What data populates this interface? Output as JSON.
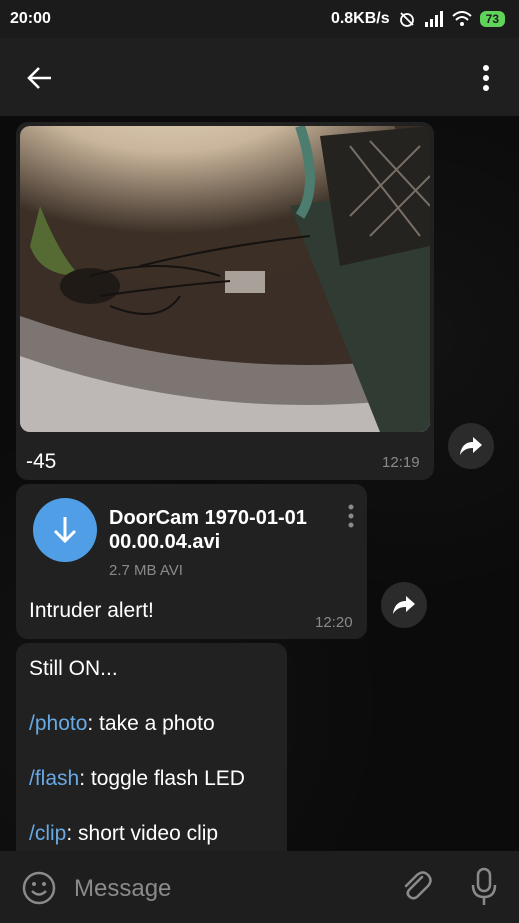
{
  "status_bar": {
    "time": "20:00",
    "network_speed": "0.8KB/s",
    "battery": "73",
    "icons": [
      "alarm-off-icon",
      "signal-icon",
      "wifi-icon",
      "battery-icon"
    ]
  },
  "app_bar": {
    "icons": [
      "back-arrow-icon",
      "more-vertical-icon"
    ]
  },
  "messages": {
    "photo": {
      "caption": "-45",
      "time": "12:19"
    },
    "file": {
      "name": "DoorCam 1970-01-01 00.00.04.avi",
      "size": "2.7 MB AVI",
      "caption": "Intruder alert!",
      "time": "12:20"
    },
    "text": {
      "intro": "Still ON...",
      "commands": [
        {
          "command": "/photo",
          "desc": ": take a photo"
        },
        {
          "command": "/flash",
          "desc": ": toggle flash LED"
        },
        {
          "command": "/clip",
          "desc": ": short video clip"
        }
      ]
    }
  },
  "composer": {
    "placeholder": "Message",
    "icons": [
      "emoji-icon",
      "paperclip-icon",
      "microphone-icon"
    ]
  },
  "colors": {
    "bubble": "#212121",
    "accent": "#4f9ee6",
    "command_link": "#68a9e3",
    "battery": "#5fd35a"
  }
}
